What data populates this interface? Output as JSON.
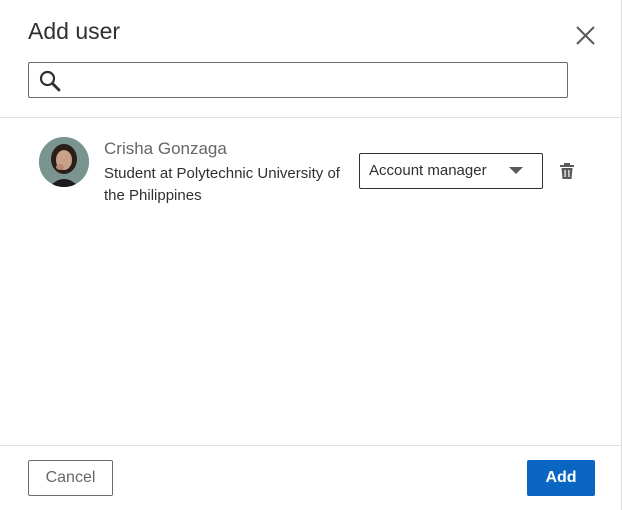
{
  "dialog": {
    "title": "Add user"
  },
  "search": {
    "value": "",
    "placeholder": ""
  },
  "users": [
    {
      "name": "Crisha Gonzaga",
      "description": "Student at Polytechnic University of the Philippines",
      "role": "Account manager"
    }
  ],
  "footer": {
    "cancel_label": "Cancel",
    "add_label": "Add"
  },
  "colors": {
    "primary": "#0a66c2",
    "text": "#303030",
    "muted": "#666666"
  },
  "icons": {
    "close": "close-icon",
    "search": "search-icon",
    "dropdown": "caret-down-icon",
    "delete": "trash-icon"
  }
}
